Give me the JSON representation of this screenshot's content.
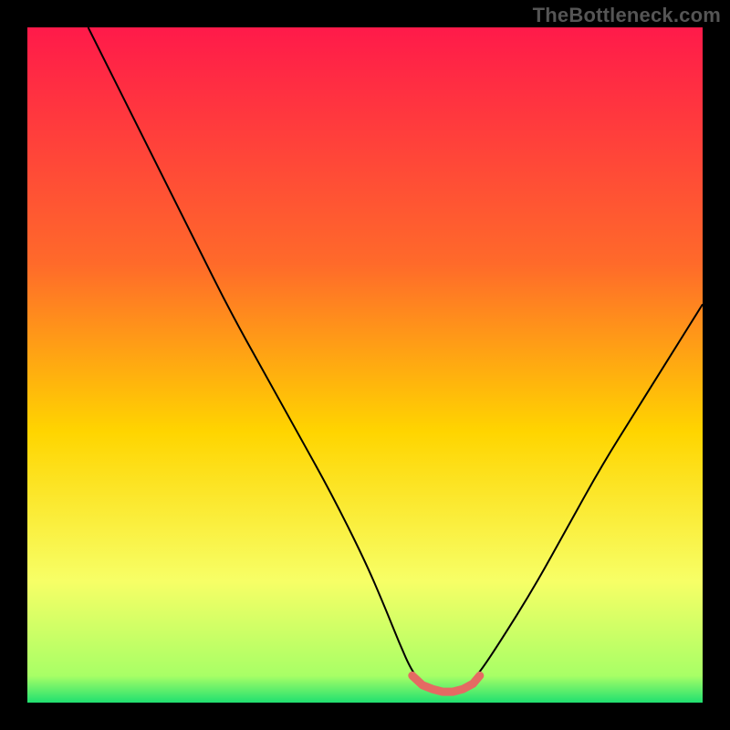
{
  "watermark": "TheBottleneck.com",
  "colors": {
    "black": "#000000",
    "curve": "#000000",
    "highlight": "#e46a63",
    "grad_top": "#ff1a4a",
    "grad_mid1": "#ff6a2a",
    "grad_mid2": "#ffd500",
    "grad_mid3": "#f7ff66",
    "grad_bottom": "#20e070"
  },
  "chart_data": {
    "type": "line",
    "title": "",
    "xlabel": "",
    "ylabel": "",
    "xlim": [
      0,
      100
    ],
    "ylim": [
      0,
      100
    ],
    "grid": false,
    "curve": {
      "name": "bottleneck-curve",
      "x": [
        9,
        15,
        20,
        25,
        30,
        35,
        40,
        45,
        50,
        53,
        55,
        57,
        59,
        61,
        63,
        65,
        67,
        70,
        75,
        80,
        85,
        90,
        95,
        100
      ],
      "y": [
        100,
        88,
        78,
        68,
        58,
        49,
        40,
        31,
        21,
        14,
        9,
        4.5,
        2.2,
        1.5,
        1.5,
        2.2,
        4.5,
        9,
        17,
        26,
        35,
        43,
        51,
        59
      ]
    },
    "highlight_segment": {
      "name": "optimal-range",
      "x": [
        57,
        58.5,
        60,
        61.5,
        63,
        64.5,
        66,
        67
      ],
      "y": [
        4.0,
        2.6,
        2.0,
        1.6,
        1.6,
        2.0,
        2.8,
        4.0
      ]
    },
    "gradient_stops": [
      {
        "offset": 0.0,
        "color": "#ff1a4a"
      },
      {
        "offset": 0.35,
        "color": "#ff6a2a"
      },
      {
        "offset": 0.6,
        "color": "#ffd500"
      },
      {
        "offset": 0.82,
        "color": "#f7ff66"
      },
      {
        "offset": 0.96,
        "color": "#a8ff66"
      },
      {
        "offset": 1.0,
        "color": "#20e070"
      }
    ]
  }
}
